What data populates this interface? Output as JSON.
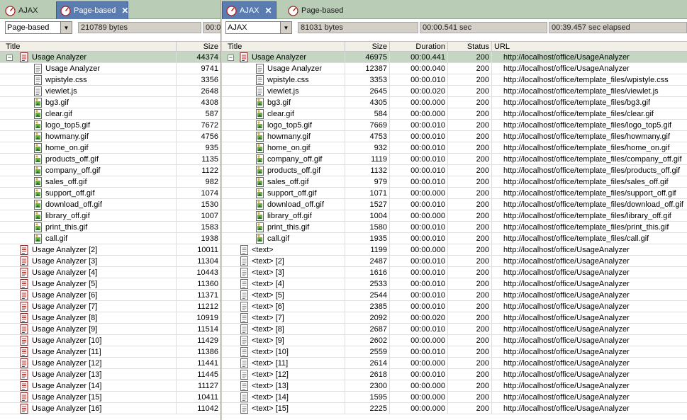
{
  "left": {
    "tabs": [
      {
        "label": "AJAX",
        "active": false
      },
      {
        "label": "Page-based",
        "active": true
      }
    ],
    "mode_select": "Page-based",
    "bytes": "210789 bytes",
    "time_partial": "00:0",
    "columns": {
      "title": "Title",
      "size": "Size"
    },
    "rows": [
      {
        "title": "Usage Analyzer",
        "size": "44374",
        "icon": "page-icon",
        "level": 0,
        "expanded": true,
        "selected": true
      },
      {
        "title": "Usage Analyzer",
        "size": "9741",
        "icon": "document-icon",
        "level": 1
      },
      {
        "title": "wpistyle.css",
        "size": "3356",
        "icon": "text-file-icon",
        "level": 1
      },
      {
        "title": "viewlet.js",
        "size": "2648",
        "icon": "text-file-icon",
        "level": 1
      },
      {
        "title": "bg3.gif",
        "size": "4308",
        "icon": "image-icon",
        "level": 1
      },
      {
        "title": "clear.gif",
        "size": "587",
        "icon": "image-icon",
        "level": 1
      },
      {
        "title": "logo_top5.gif",
        "size": "7672",
        "icon": "image-icon",
        "level": 1
      },
      {
        "title": "howmany.gif",
        "size": "4756",
        "icon": "image-icon",
        "level": 1
      },
      {
        "title": "home_on.gif",
        "size": "935",
        "icon": "image-icon",
        "level": 1
      },
      {
        "title": "products_off.gif",
        "size": "1135",
        "icon": "image-icon",
        "level": 1
      },
      {
        "title": "company_off.gif",
        "size": "1122",
        "icon": "image-icon",
        "level": 1
      },
      {
        "title": "sales_off.gif",
        "size": "982",
        "icon": "image-icon",
        "level": 1
      },
      {
        "title": "support_off.gif",
        "size": "1074",
        "icon": "image-icon",
        "level": 1
      },
      {
        "title": "download_off.gif",
        "size": "1530",
        "icon": "image-icon",
        "level": 1
      },
      {
        "title": "library_off.gif",
        "size": "1007",
        "icon": "image-icon",
        "level": 1
      },
      {
        "title": "print_this.gif",
        "size": "1583",
        "icon": "image-icon",
        "level": 1
      },
      {
        "title": "call.gif",
        "size": "1938",
        "icon": "image-icon",
        "level": 1
      },
      {
        "title": "Usage Analyzer [2]",
        "size": "10011",
        "icon": "page-icon",
        "level": 0
      },
      {
        "title": "Usage Analyzer [3]",
        "size": "11304",
        "icon": "page-icon",
        "level": 0
      },
      {
        "title": "Usage Analyzer [4]",
        "size": "10443",
        "icon": "page-icon",
        "level": 0
      },
      {
        "title": "Usage Analyzer [5]",
        "size": "11360",
        "icon": "page-icon",
        "level": 0
      },
      {
        "title": "Usage Analyzer [6]",
        "size": "11371",
        "icon": "page-icon",
        "level": 0
      },
      {
        "title": "Usage Analyzer [7]",
        "size": "11212",
        "icon": "page-icon",
        "level": 0
      },
      {
        "title": "Usage Analyzer [8]",
        "size": "10919",
        "icon": "page-icon",
        "level": 0
      },
      {
        "title": "Usage Analyzer [9]",
        "size": "11514",
        "icon": "page-icon",
        "level": 0
      },
      {
        "title": "Usage Analyzer [10]",
        "size": "11429",
        "icon": "page-icon",
        "level": 0
      },
      {
        "title": "Usage Analyzer [11]",
        "size": "11386",
        "icon": "page-icon",
        "level": 0
      },
      {
        "title": "Usage Analyzer [12]",
        "size": "11441",
        "icon": "page-icon",
        "level": 0
      },
      {
        "title": "Usage Analyzer [13]",
        "size": "11445",
        "icon": "page-icon",
        "level": 0
      },
      {
        "title": "Usage Analyzer [14]",
        "size": "11127",
        "icon": "page-icon",
        "level": 0
      },
      {
        "title": "Usage Analyzer [15]",
        "size": "10411",
        "icon": "page-icon",
        "level": 0
      },
      {
        "title": "Usage Analyzer [16]",
        "size": "11042",
        "icon": "page-icon",
        "level": 0
      }
    ]
  },
  "right": {
    "tabs": [
      {
        "label": "AJAX",
        "active": true
      },
      {
        "label": "Page-based",
        "active": false
      }
    ],
    "mode_select": "AJAX",
    "bytes": "81031 bytes",
    "duration": "00:00.541 sec",
    "elapsed": "00:39.457 sec elapsed",
    "columns": {
      "title": "Title",
      "size": "Size",
      "duration": "Duration",
      "status": "Status",
      "url": "URL"
    },
    "rows": [
      {
        "title": "Usage Analyzer",
        "size": "46975",
        "duration": "00:00.441",
        "status": "200",
        "url": "http://localhost/office/UsageAnalyzer",
        "icon": "page-icon",
        "level": 0,
        "expanded": true,
        "selected": true
      },
      {
        "title": "Usage Analyzer",
        "size": "12387",
        "duration": "00:00.040",
        "status": "200",
        "url": "http://localhost/office/UsageAnalyzer",
        "icon": "document-icon",
        "level": 1
      },
      {
        "title": "wpistyle.css",
        "size": "3353",
        "duration": "00:00.010",
        "status": "200",
        "url": "http://localhost/office/template_files/wpistyle.css",
        "icon": "text-file-icon",
        "level": 1
      },
      {
        "title": "viewlet.js",
        "size": "2645",
        "duration": "00:00.020",
        "status": "200",
        "url": "http://localhost/office/template_files/viewlet.js",
        "icon": "text-file-icon",
        "level": 1
      },
      {
        "title": "bg3.gif",
        "size": "4305",
        "duration": "00:00.000",
        "status": "200",
        "url": "http://localhost/office/template_files/bg3.gif",
        "icon": "image-icon",
        "level": 1
      },
      {
        "title": "clear.gif",
        "size": "584",
        "duration": "00:00.000",
        "status": "200",
        "url": "http://localhost/office/template_files/clear.gif",
        "icon": "image-icon",
        "level": 1
      },
      {
        "title": "logo_top5.gif",
        "size": "7669",
        "duration": "00:00.010",
        "status": "200",
        "url": "http://localhost/office/template_files/logo_top5.gif",
        "icon": "image-icon",
        "level": 1
      },
      {
        "title": "howmany.gif",
        "size": "4753",
        "duration": "00:00.010",
        "status": "200",
        "url": "http://localhost/office/template_files/howmany.gif",
        "icon": "image-icon",
        "level": 1
      },
      {
        "title": "home_on.gif",
        "size": "932",
        "duration": "00:00.010",
        "status": "200",
        "url": "http://localhost/office/template_files/home_on.gif",
        "icon": "image-icon",
        "level": 1
      },
      {
        "title": "company_off.gif",
        "size": "1119",
        "duration": "00:00.010",
        "status": "200",
        "url": "http://localhost/office/template_files/company_off.gif",
        "icon": "image-icon",
        "level": 1
      },
      {
        "title": "products_off.gif",
        "size": "1132",
        "duration": "00:00.010",
        "status": "200",
        "url": "http://localhost/office/template_files/products_off.gif",
        "icon": "image-icon",
        "level": 1
      },
      {
        "title": "sales_off.gif",
        "size": "979",
        "duration": "00:00.010",
        "status": "200",
        "url": "http://localhost/office/template_files/sales_off.gif",
        "icon": "image-icon",
        "level": 1
      },
      {
        "title": "support_off.gif",
        "size": "1071",
        "duration": "00:00.000",
        "status": "200",
        "url": "http://localhost/office/template_files/support_off.gif",
        "icon": "image-icon",
        "level": 1
      },
      {
        "title": "download_off.gif",
        "size": "1527",
        "duration": "00:00.010",
        "status": "200",
        "url": "http://localhost/office/template_files/download_off.gif",
        "icon": "image-icon",
        "level": 1
      },
      {
        "title": "library_off.gif",
        "size": "1004",
        "duration": "00:00.000",
        "status": "200",
        "url": "http://localhost/office/template_files/library_off.gif",
        "icon": "image-icon",
        "level": 1
      },
      {
        "title": "print_this.gif",
        "size": "1580",
        "duration": "00:00.010",
        "status": "200",
        "url": "http://localhost/office/template_files/print_this.gif",
        "icon": "image-icon",
        "level": 1
      },
      {
        "title": "call.gif",
        "size": "1935",
        "duration": "00:00.010",
        "status": "200",
        "url": "http://localhost/office/template_files/call.gif",
        "icon": "image-icon",
        "level": 1
      },
      {
        "title": "<text>",
        "size": "1199",
        "duration": "00:00.000",
        "status": "200",
        "url": "http://localhost/office/UsageAnalyzer",
        "icon": "text-doc-icon",
        "level": 0
      },
      {
        "title": "<text> [2]",
        "size": "2487",
        "duration": "00:00.010",
        "status": "200",
        "url": "http://localhost/office/UsageAnalyzer",
        "icon": "text-doc-icon",
        "level": 0
      },
      {
        "title": "<text> [3]",
        "size": "1616",
        "duration": "00:00.010",
        "status": "200",
        "url": "http://localhost/office/UsageAnalyzer",
        "icon": "text-doc-icon",
        "level": 0
      },
      {
        "title": "<text> [4]",
        "size": "2533",
        "duration": "00:00.010",
        "status": "200",
        "url": "http://localhost/office/UsageAnalyzer",
        "icon": "text-doc-icon",
        "level": 0
      },
      {
        "title": "<text> [5]",
        "size": "2544",
        "duration": "00:00.010",
        "status": "200",
        "url": "http://localhost/office/UsageAnalyzer",
        "icon": "text-doc-icon",
        "level": 0
      },
      {
        "title": "<text> [6]",
        "size": "2385",
        "duration": "00:00.010",
        "status": "200",
        "url": "http://localhost/office/UsageAnalyzer",
        "icon": "text-doc-icon",
        "level": 0
      },
      {
        "title": "<text> [7]",
        "size": "2092",
        "duration": "00:00.020",
        "status": "200",
        "url": "http://localhost/office/UsageAnalyzer",
        "icon": "text-doc-icon",
        "level": 0
      },
      {
        "title": "<text> [8]",
        "size": "2687",
        "duration": "00:00.010",
        "status": "200",
        "url": "http://localhost/office/UsageAnalyzer",
        "icon": "text-doc-icon",
        "level": 0
      },
      {
        "title": "<text> [9]",
        "size": "2602",
        "duration": "00:00.000",
        "status": "200",
        "url": "http://localhost/office/UsageAnalyzer",
        "icon": "text-doc-icon",
        "level": 0
      },
      {
        "title": "<text> [10]",
        "size": "2559",
        "duration": "00:00.010",
        "status": "200",
        "url": "http://localhost/office/UsageAnalyzer",
        "icon": "text-doc-icon",
        "level": 0
      },
      {
        "title": "<text> [11]",
        "size": "2614",
        "duration": "00:00.000",
        "status": "200",
        "url": "http://localhost/office/UsageAnalyzer",
        "icon": "text-doc-icon",
        "level": 0
      },
      {
        "title": "<text> [12]",
        "size": "2618",
        "duration": "00:00.010",
        "status": "200",
        "url": "http://localhost/office/UsageAnalyzer",
        "icon": "text-doc-icon",
        "level": 0
      },
      {
        "title": "<text> [13]",
        "size": "2300",
        "duration": "00:00.000",
        "status": "200",
        "url": "http://localhost/office/UsageAnalyzer",
        "icon": "text-doc-icon",
        "level": 0
      },
      {
        "title": "<text> [14]",
        "size": "1595",
        "duration": "00:00.000",
        "status": "200",
        "url": "http://localhost/office/UsageAnalyzer",
        "icon": "text-doc-icon",
        "level": 0
      },
      {
        "title": "<text> [15]",
        "size": "2225",
        "duration": "00:00.000",
        "status": "200",
        "url": "http://localhost/office/UsageAnalyzer",
        "icon": "text-doc-icon",
        "level": 0
      }
    ]
  },
  "colors": {
    "tabbar": "#b8ccb6",
    "active_tab": "#5a7cb0",
    "selected_row": "#c5d6c3",
    "field_bg": "#d4d0c8"
  }
}
